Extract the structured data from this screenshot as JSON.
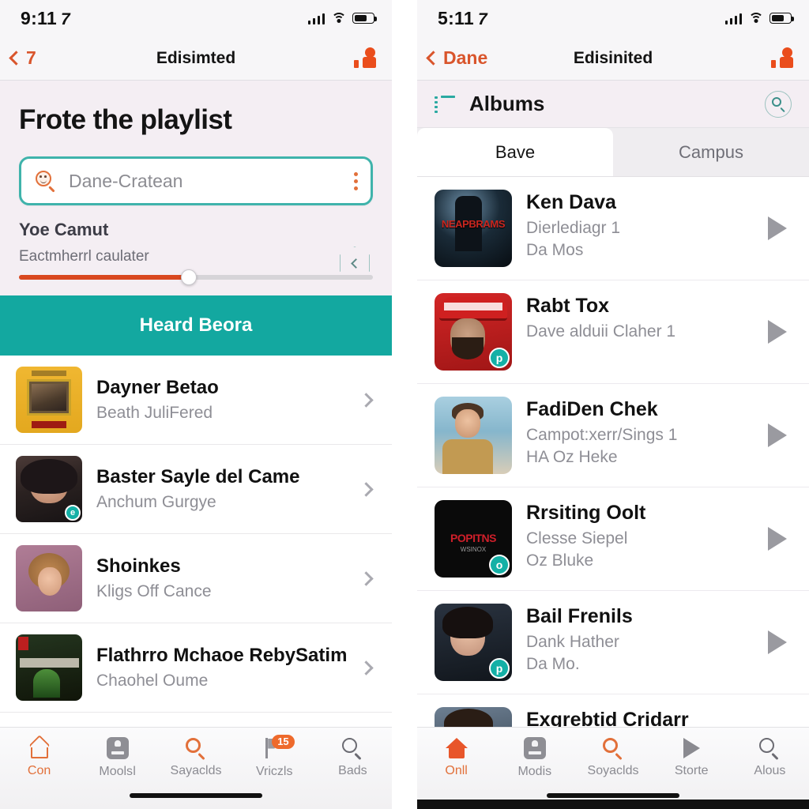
{
  "left": {
    "status": {
      "time": "9:11",
      "location_glyph": "7"
    },
    "nav": {
      "back_label": "7",
      "title": "Edisimted",
      "profile_icon": "person-icon"
    },
    "hero": {
      "title": "Frote the playlist",
      "search_value": "Dane-Cratean",
      "search_icon": "search-face-icon",
      "menu_icon": "kebab-menu-icon",
      "section_label": "Yoe Camut",
      "slider_caption": "Eactmherrl caulater",
      "slider_percent": 48,
      "collapse_icon": "chevron-left-icon"
    },
    "banner": {
      "label": "Heard Beora"
    },
    "rows": [
      {
        "title": "Dayner Betao",
        "subtitle": "Beath  JuliFered",
        "art": "art-yellow",
        "badge": ""
      },
      {
        "title": "Baster Sayle del Came",
        "subtitle": "Anchum Gurgye",
        "art": "art-face1",
        "badge": "e"
      },
      {
        "title": "Shoinkes",
        "subtitle": "Kligs Off Cance",
        "art": "art-curly",
        "badge": ""
      },
      {
        "title": "Flathrro Mchaoe RebySatime",
        "subtitle": "Chaohel Oume",
        "art": "art-dark",
        "badge": ""
      }
    ],
    "tabs": [
      {
        "label": "Con",
        "icon": "home-outline-icon",
        "active": true,
        "badge": ""
      },
      {
        "label": "Moolsǀ",
        "icon": "stamp-icon",
        "active": false,
        "badge": ""
      },
      {
        "label": "Sayaclds",
        "icon": "search-icon",
        "active": false,
        "badge": ""
      },
      {
        "label": "Vriczls",
        "icon": "flag-icon",
        "active": false,
        "badge": "15"
      },
      {
        "label": "Bads",
        "icon": "search-icon",
        "active": false,
        "badge": ""
      }
    ]
  },
  "right": {
    "status": {
      "time": "5:11",
      "location_glyph": "7"
    },
    "nav": {
      "back_label": "Dane",
      "title": "Edisinited",
      "profile_icon": "person-icon"
    },
    "albums": {
      "label": "Albums",
      "list_icon": "list-icon",
      "search_icon": "search-circle-icon"
    },
    "segments": [
      {
        "label": "Bave",
        "active": true
      },
      {
        "label": "Campus",
        "active": false
      }
    ],
    "rows": [
      {
        "title": "Ken Dava",
        "line2": "Dierlediagr 1",
        "line3": "Da Mos",
        "art": "art-neap",
        "badge": ""
      },
      {
        "title": "Rabt Tox",
        "line2": "Dave alduii Claher 1",
        "line3": "",
        "art": "art-red",
        "badge": "p"
      },
      {
        "title": "FadiDen Chek",
        "line2": "Campot:xerr/Sings 1",
        "line3": "HA Oz Heke",
        "art": "art-beach",
        "badge": ""
      },
      {
        "title": "Rrsiting Oolt",
        "line2": "Clesse Siepel",
        "line3": "Oz Bluke",
        "art": "art-black",
        "badge": "o"
      },
      {
        "title": "Bail Frenils",
        "line2": "Dank Hather",
        "line3": "Da Mo.",
        "art": "art-face2",
        "badge": "p"
      },
      {
        "title": "Exgrebtid Cridarr",
        "line2": "",
        "line3": "",
        "art": "art-face3",
        "badge": ""
      }
    ],
    "tabs": [
      {
        "label": "Onll",
        "icon": "home-filled-icon",
        "active": true,
        "badge": ""
      },
      {
        "label": "Modis",
        "icon": "stamp-icon",
        "active": false,
        "badge": ""
      },
      {
        "label": "Soyaclds",
        "icon": "search-icon",
        "active": false,
        "badge": ""
      },
      {
        "label": "Storte",
        "icon": "play-icon",
        "active": false,
        "badge": ""
      },
      {
        "label": "Alous",
        "icon": "search-icon",
        "active": false,
        "badge": ""
      }
    ]
  },
  "colors": {
    "teal": "#13a8a0",
    "orange": "#e2703a",
    "red_orange": "#d9481f",
    "hero_bg": "#f4eef3"
  }
}
